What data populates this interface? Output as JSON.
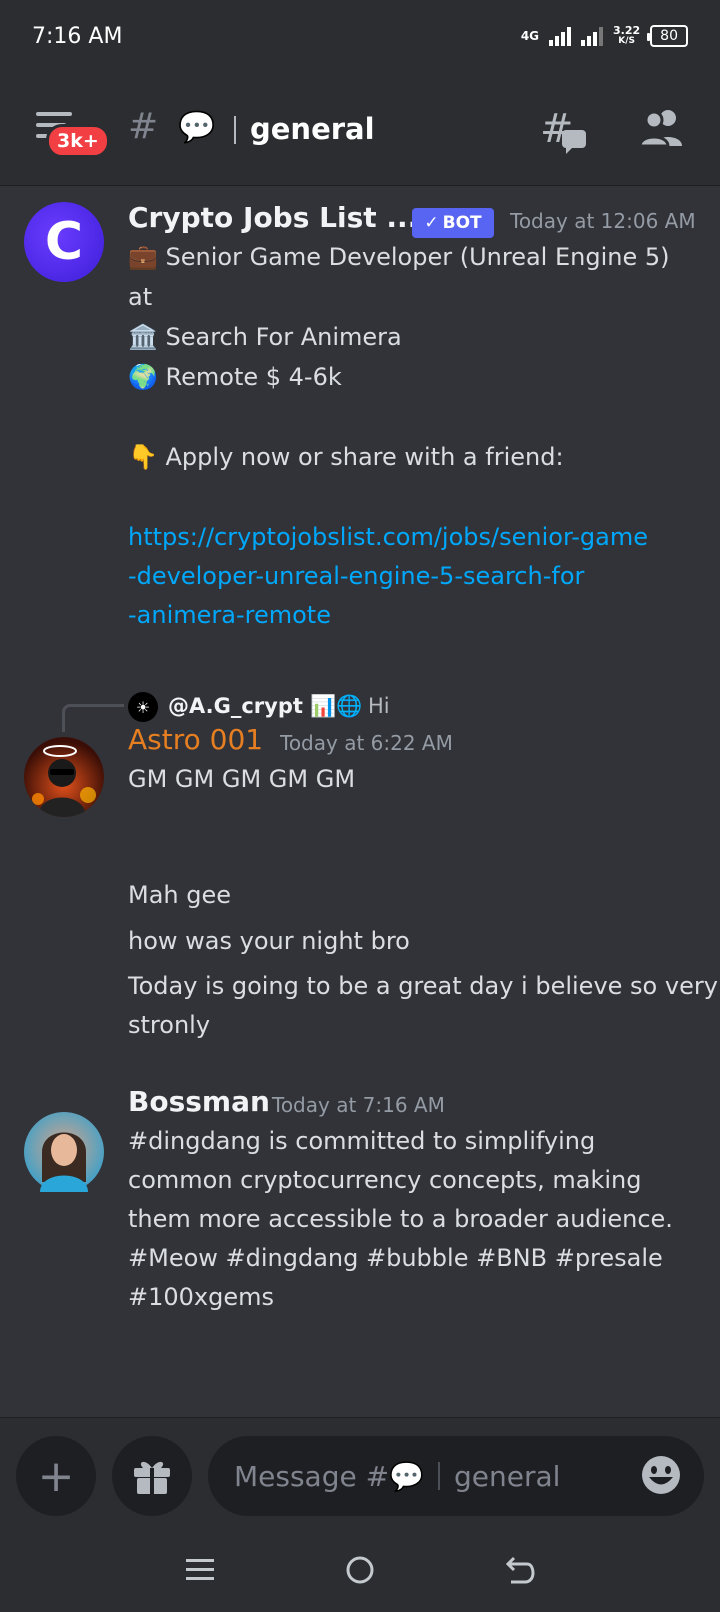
{
  "status_bar": {
    "time": "7:16 AM",
    "network": "4G",
    "speed_value": "3.22",
    "speed_unit": "K/S",
    "battery": "80"
  },
  "header": {
    "badge": "3k+",
    "hash": "#",
    "channel_emoji": "💬",
    "channel_name": "general",
    "icons": [
      "menu-icon",
      "threads-icon",
      "members-icon"
    ]
  },
  "messages": [
    {
      "author": "Crypto Jobs List ...",
      "bot_label": "BOT",
      "timestamp": "Today at 12:06 AM",
      "lines": [
        "💼 Senior Game Developer (Unreal Engine 5)",
        "at",
        "🏛️ Search For Animera",
        "🌍 Remote $ 4-6k",
        "👇 Apply now or share with a friend:"
      ],
      "link_lines": [
        "https://cryptojobslist.com/jobs/senior-game",
        "-developer-unreal-engine-5-search-for",
        "-animera-remote"
      ]
    },
    {
      "reply_to": "@A.G_crypt 📊🌐",
      "reply_text": "Hi",
      "author": "Astro 001",
      "author_color": "#e67e22",
      "timestamp": "Today at 6:22 AM",
      "lines": [
        "GM GM GM GM GM",
        "Mah gee",
        "how was your night bro",
        "Today is going to be a great day i believe so very",
        "stronly"
      ]
    },
    {
      "author": "Bossman",
      "timestamp": "Today at 7:16 AM",
      "lines": [
        "#dingdang is committed to simplifying",
        "common cryptocurrency concepts, making",
        "them more accessible to a broader audience.",
        "#Meow #dingdang #bubble #BNB #presale",
        "#100xgems"
      ]
    }
  ],
  "composer": {
    "placeholder_prefix": "Message #",
    "placeholder_emoji": "💬",
    "placeholder_channel": "general"
  },
  "colors": {
    "background": "#313338",
    "link": "#00a8fc",
    "bot_tag": "#5865f2",
    "badge": "#f23f43"
  }
}
